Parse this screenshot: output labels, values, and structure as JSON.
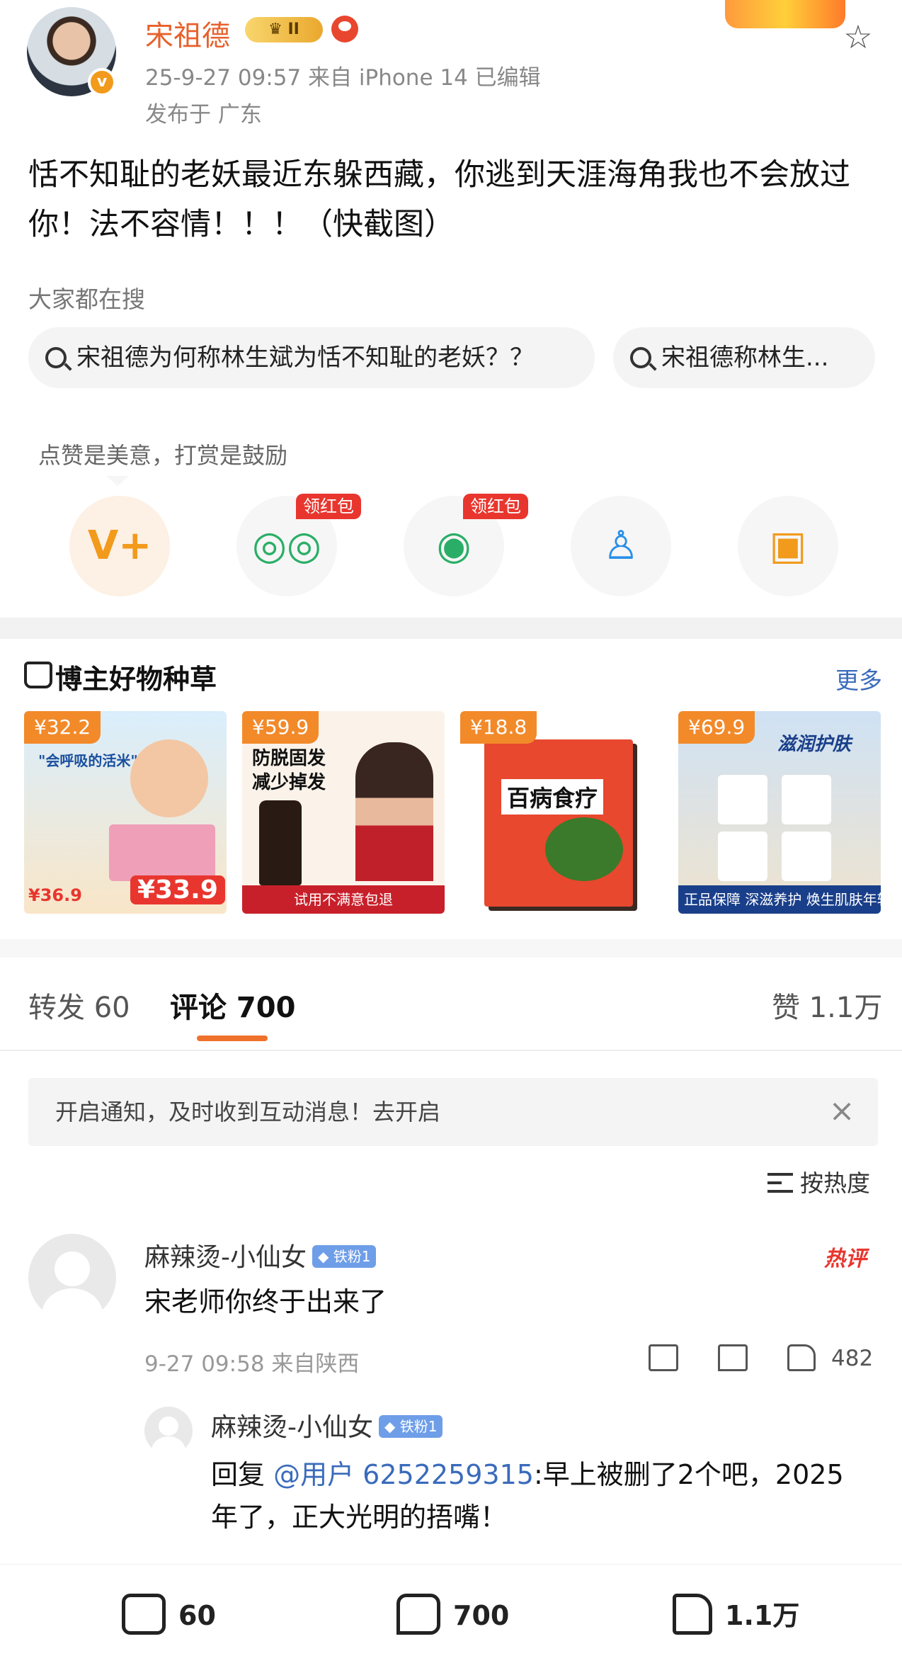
{
  "post": {
    "author": "宋祖德",
    "vip_level": "II",
    "verified_mark": "v",
    "meta": "25-9-27 09:57  来自 iPhone 14  已编辑",
    "location": "发布于 广东",
    "text": "恬不知耻的老妖最近东躲西藏，你逃到天涯海角我也不会放过你！法不容情！！！（快截图）"
  },
  "search": {
    "title": "大家都在搜",
    "chips": [
      "宋祖德为何称林生斌为恬不知耻的老妖？？",
      "宋祖德称林生..."
    ]
  },
  "share": {
    "title": "点赞是美意，打赏是鼓励",
    "redpack_label": "领红包",
    "buttons": [
      {
        "icon": "reward-v-icon"
      },
      {
        "icon": "wechat-icon"
      },
      {
        "icon": "moments-icon"
      },
      {
        "icon": "qq-icon"
      },
      {
        "icon": "save-image-icon"
      }
    ]
  },
  "shop": {
    "title": "博主好物种草",
    "more": "更多",
    "products": [
      {
        "price": "¥32.2",
        "headline": "\"会呼吸的活米\"",
        "promo": "¥33.9",
        "old_price": "¥36.9"
      },
      {
        "price": "¥59.9",
        "headline": "防脱固发 减少掉发",
        "strip": "试用不满意包退"
      },
      {
        "price": "¥18.8",
        "headline": "百病食疗"
      },
      {
        "price": "¥69.9",
        "headline": "滋润护肤",
        "strip": "正品保障  深滋养护 焕生肌肤年轻力"
      }
    ],
    "colors": {
      "price_tag": "#f28a2a"
    }
  },
  "tabs": {
    "repost": "转发 60",
    "comments": "评论 700",
    "likes": "赞 1.1万"
  },
  "notice": {
    "text": "开启通知，及时收到互动消息！去开启",
    "close_icon": "close-icon"
  },
  "sort": {
    "label": "按热度"
  },
  "comments": [
    {
      "user": "麻辣烫-小仙女",
      "badge": "铁粉1",
      "hot": "热评",
      "text": "宋老师你终于出来了",
      "meta": "9-27 09:58  来自陕西",
      "likes": "482"
    }
  ],
  "reply": {
    "user": "麻辣烫-小仙女",
    "badge": "铁粉1",
    "prefix": "回复 ",
    "mention": "@用户 6252259315",
    "text": ":早上被删了2个吧，2025年了，正大光明的捂嘴！"
  },
  "bottom_bar": {
    "repost": "60",
    "comment": "700",
    "like": "1.1万"
  },
  "colors": {
    "accent": "#f0712c",
    "author_name": "#e8602c",
    "link": "#3a6bbb",
    "hot": "#e8362e"
  }
}
